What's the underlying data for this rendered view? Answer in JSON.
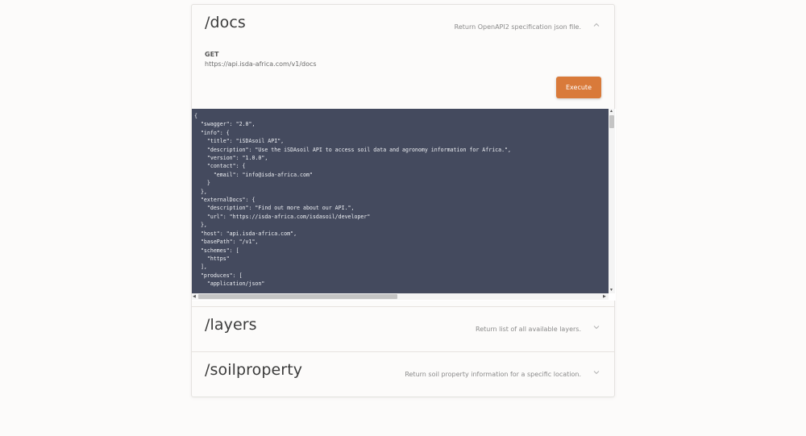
{
  "sections": [
    {
      "path": "/docs",
      "description": "Return OpenAPI2 specification json file.",
      "expanded": true,
      "method": "GET",
      "url": "https://api.isda-africa.com/v1/docs",
      "execute_label": "Execute",
      "response_lines": [
        "{",
        "  \"swagger\": \"2.0\",",
        "  \"info\": {",
        "    \"title\": \"iSDAsoil API\",",
        "    \"description\": \"Use the iSDAsoil API to access soil data and agronomy information for Africa.\",",
        "    \"version\": \"1.0.0\",",
        "    \"contact\": {",
        "      \"email\": \"info@isda-africa.com\"",
        "    }",
        "  },",
        "  \"externalDocs\": {",
        "    \"description\": \"Find out more about our API.\",",
        "    \"url\": \"https://isda-africa.com/isdasoil/developer\"",
        "  },",
        "  \"host\": \"api.isda-africa.com\",",
        "  \"basePath\": \"/v1\",",
        "  \"schemes\": [",
        "    \"https\"",
        "  ],",
        "  \"produces\": [",
        "    \"application/json\""
      ]
    },
    {
      "path": "/layers",
      "description": "Return list of all available layers.",
      "expanded": false
    },
    {
      "path": "/soilproperty",
      "description": "Return soil property information for a specific location.",
      "expanded": false
    }
  ],
  "icons": {
    "collapse": "chevron-up-icon",
    "expand": "chevron-down-icon"
  },
  "colors": {
    "accent": "#d97a3a",
    "code_bg": "#444a5e",
    "page_bg": "#fcfbfa"
  }
}
